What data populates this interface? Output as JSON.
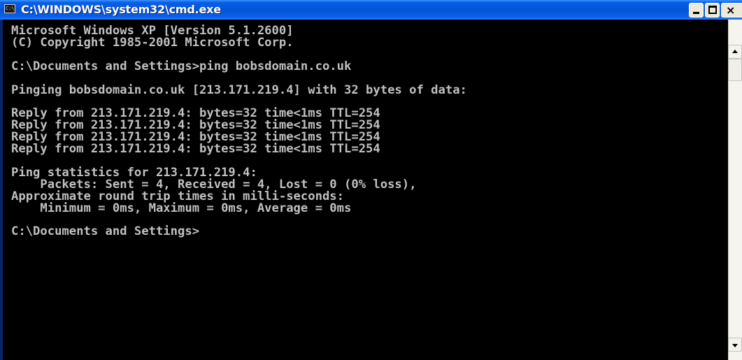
{
  "window": {
    "title": "C:\\WINDOWS\\system32\\cmd.exe",
    "icon": "cmd-icon",
    "icon_text": "C:\\",
    "minimize_icon": "minimize-icon",
    "maximize_icon": "maximize-icon",
    "close_icon": "close-icon",
    "close_glyph": "×"
  },
  "console": {
    "lines": [
      "Microsoft Windows XP [Version 5.1.2600]",
      "(C) Copyright 1985-2001 Microsoft Corp.",
      "",
      "C:\\Documents and Settings>ping bobsdomain.co.uk",
      "",
      "Pinging bobsdomain.co.uk [213.171.219.4] with 32 bytes of data:",
      "",
      "Reply from 213.171.219.4: bytes=32 time<1ms TTL=254",
      "Reply from 213.171.219.4: bytes=32 time<1ms TTL=254",
      "Reply from 213.171.219.4: bytes=32 time<1ms TTL=254",
      "Reply from 213.171.219.4: bytes=32 time<1ms TTL=254",
      "",
      "Ping statistics for 213.171.219.4:",
      "    Packets: Sent = 4, Received = 4, Lost = 0 (0% loss),",
      "Approximate round trip times in milli-seconds:",
      "    Minimum = 0ms, Maximum = 0ms, Average = 0ms",
      "",
      "C:\\Documents and Settings>"
    ],
    "text_color": "#c0c0c0",
    "background": "#000000"
  },
  "scrollbar": {
    "up_icon": "scroll-up-arrow-icon",
    "down_icon": "scroll-down-arrow-icon"
  },
  "colors": {
    "titlebar": "#0453d8",
    "title_text": "#ffffff"
  }
}
